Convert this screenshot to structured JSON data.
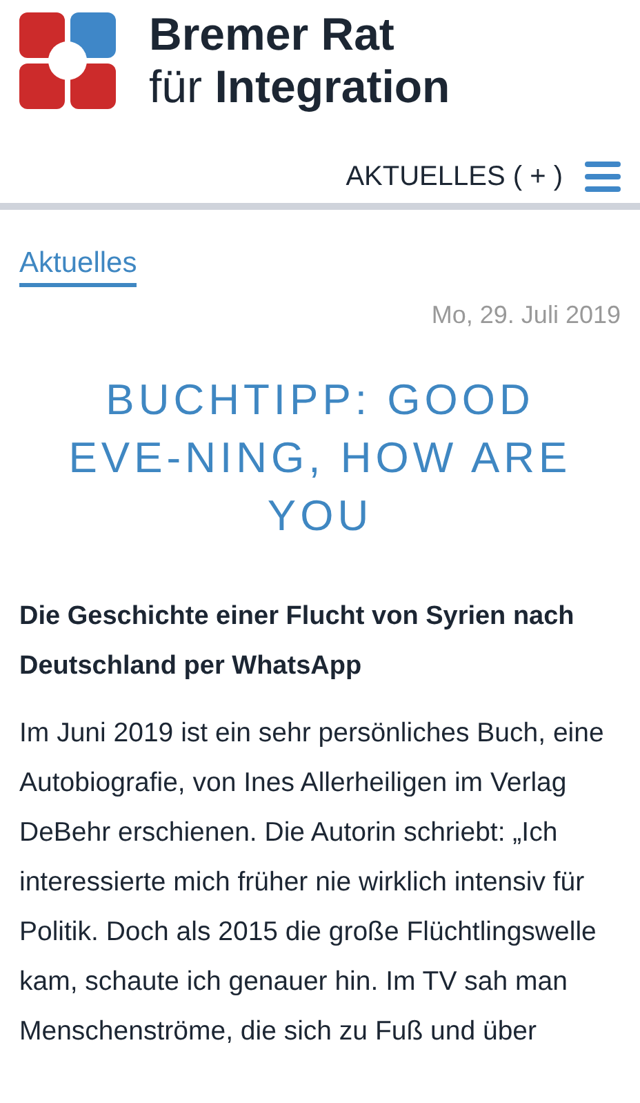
{
  "header": {
    "logo_lines": [
      "Bremer Rat",
      "für **Integration**"
    ],
    "nav_label": "AKTUELLES ( + )"
  },
  "article": {
    "category": "Aktuelles",
    "date": "Mo, 29. Juli 2019",
    "title": "BUCHTIPP: GOOD EVE-NING, HOW ARE YOU",
    "subtitle": "Die Geschichte einer Flucht von Syrien nach Deutschland per WhatsApp",
    "paragraphs": [
      "Im Juni 2019 ist ein sehr persönliches Buch, eine Autobiografie, von Ines Allerheiligen im Verlag DeBehr erschienen. Die Autorin schriebt: „Ich interessierte mich früher nie wirklich intensiv für Politik. Doch als 2015 die große Flüchtlingswelle kam, schaute ich genauer hin. Im TV sah man Menschenströme, die sich zu Fuß und über"
    ]
  }
}
